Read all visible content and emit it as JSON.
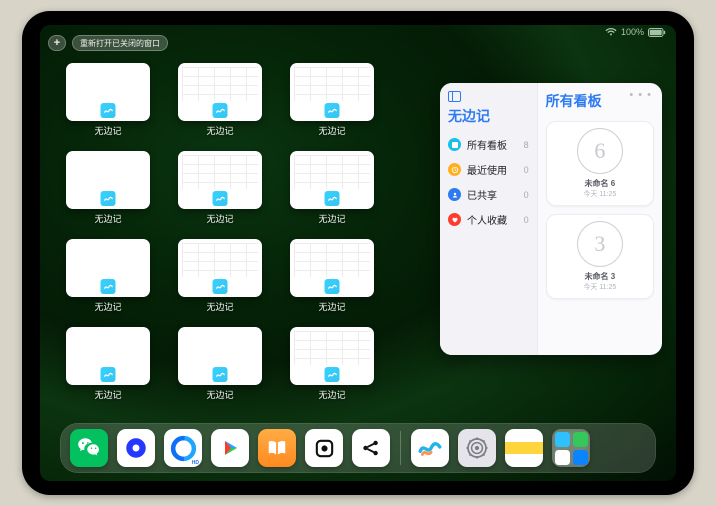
{
  "status": {
    "signal": "􀙇",
    "battery": "100%"
  },
  "top": {
    "plus": "+",
    "reopen": "重新打开已关闭的窗口"
  },
  "app_label": "无边记",
  "windows": [
    {
      "label": "无边记",
      "style": "blank"
    },
    {
      "label": "无边记",
      "style": "grid"
    },
    {
      "label": "无边记",
      "style": "grid"
    },
    {
      "label": "无边记",
      "style": "blank"
    },
    {
      "label": "无边记",
      "style": "grid"
    },
    {
      "label": "无边记",
      "style": "grid"
    },
    {
      "label": "无边记",
      "style": "blank"
    },
    {
      "label": "无边记",
      "style": "grid"
    },
    {
      "label": "无边记",
      "style": "grid"
    },
    {
      "label": "无边记",
      "style": "blank"
    },
    {
      "label": "无边记",
      "style": "blank"
    },
    {
      "label": "无边记",
      "style": "grid"
    }
  ],
  "card": {
    "nav_title": "无边记",
    "main_title": "所有看板",
    "ellipsis": "• • •",
    "items": [
      {
        "icon_color": "#18c0e8",
        "label": "所有看板",
        "count": "8"
      },
      {
        "icon_color": "#ffb021",
        "label": "最近使用",
        "count": "0"
      },
      {
        "icon_color": "#2d7bf0",
        "label": "已共享",
        "count": "0"
      },
      {
        "icon_color": "#ff3b30",
        "label": "个人收藏",
        "count": "0"
      }
    ],
    "tiles": [
      {
        "glyph": "6",
        "name": "未命名 6",
        "date": "今天 11:25"
      },
      {
        "glyph": "3",
        "name": "未命名 3",
        "date": "今天 11:25"
      }
    ]
  },
  "dock": {
    "apps": [
      {
        "name": "wechat",
        "bg": "#04c160"
      },
      {
        "name": "quark",
        "bg": "#ffffff"
      },
      {
        "name": "qqbrowser-hd",
        "bg": "#ffffff"
      },
      {
        "name": "video",
        "bg": "#ffffff"
      },
      {
        "name": "books",
        "bg": "#ff9a2e"
      },
      {
        "name": "game",
        "bg": "#ffffff"
      },
      {
        "name": "share",
        "bg": "#ffffff"
      },
      {
        "name": "freeform",
        "bg": "#ffffff"
      },
      {
        "name": "settings",
        "bg": "#e4e4ea"
      },
      {
        "name": "notes",
        "bg": "#ffffff"
      }
    ]
  }
}
